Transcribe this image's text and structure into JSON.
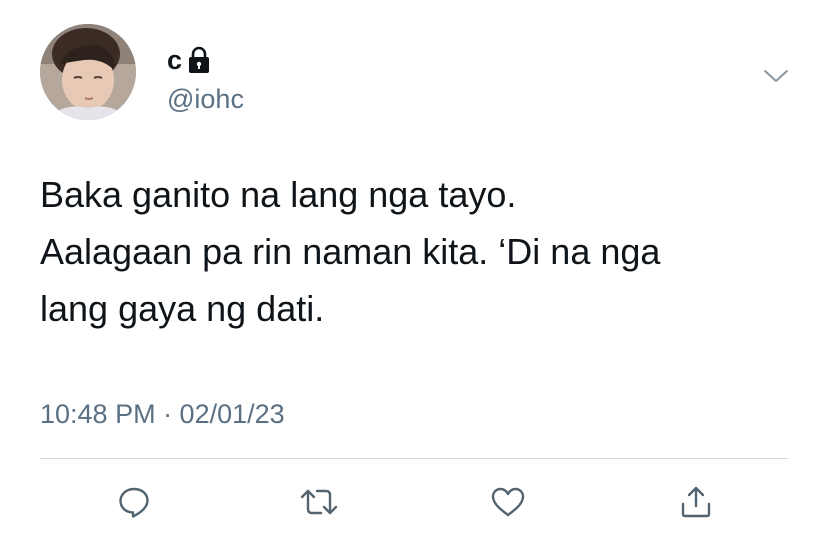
{
  "user": {
    "display_name": "c",
    "handle": "@iohc",
    "protected_icon": "lock-icon"
  },
  "tweet": {
    "text": "Baka ganito na lang nga tayo.\nAalagaan pa rin naman kita. ‘Di na nga\nlang gaya ng dati.",
    "timestamp": "10:48 PM · 02/01/23"
  },
  "actions": {
    "reply_icon": "comment-icon",
    "retweet_icon": "retweet-icon",
    "like_icon": "heart-icon",
    "share_icon": "share-icon"
  },
  "colors": {
    "text": "#0f1419",
    "secondary": "#5b7083",
    "divider": "#cfd9de",
    "icon": "#536471"
  }
}
